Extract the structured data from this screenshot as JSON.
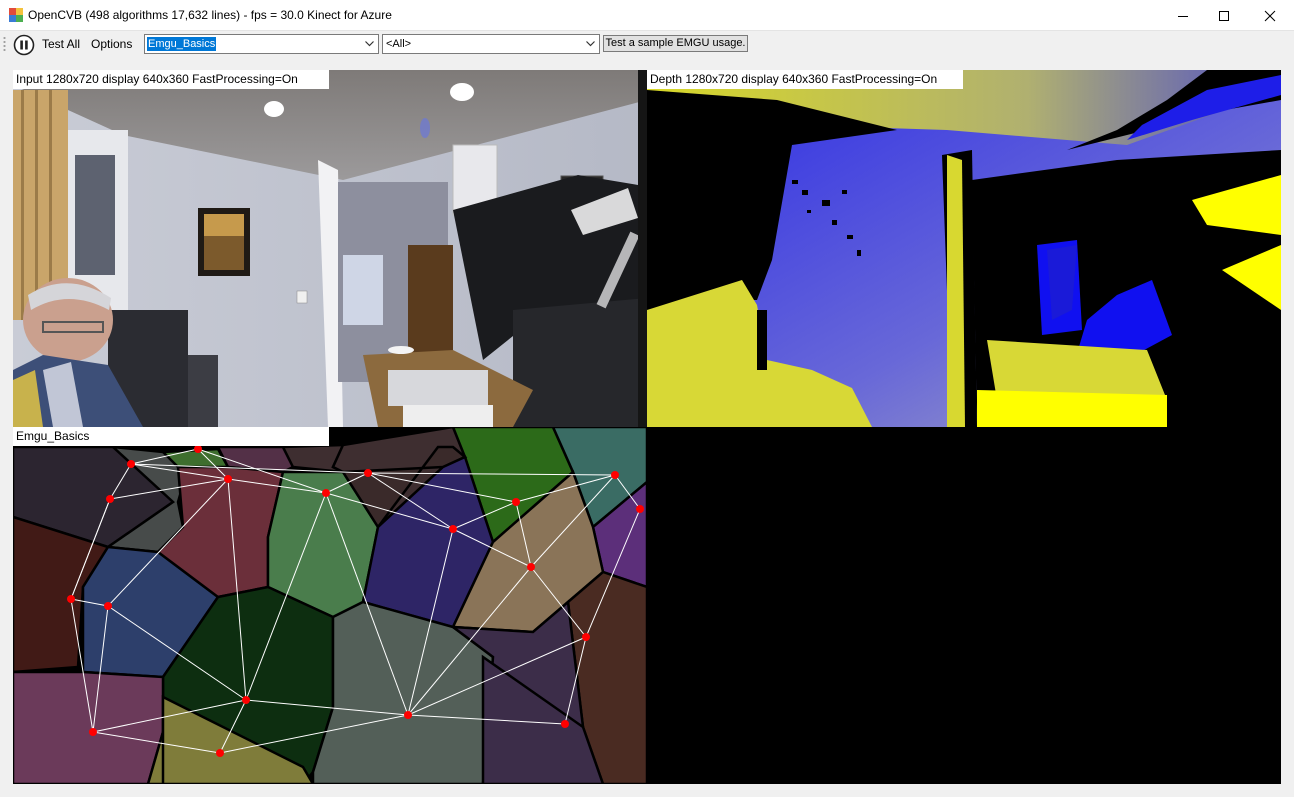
{
  "window": {
    "title": "OpenCVB (498 algorithms 17,632 lines) - fps = 30.0 Kinect for Azure",
    "app_icon": "opencvb-app-icon",
    "controls": [
      "minimize-icon",
      "maximize-icon",
      "close-icon"
    ]
  },
  "toolbar": {
    "pause_icon": "pause-icon",
    "test_all_label": "Test All",
    "options_label": "Options",
    "algorithm_combo": {
      "value": "Emgu_Basics"
    },
    "group_combo": {
      "value": "<All>"
    },
    "description_button": "Test a sample EMGU usage."
  },
  "panels": {
    "input": {
      "label": "Input  1280x720  display  640x360  FastProcessing=On"
    },
    "depth": {
      "label": "Depth  1280x720  display  640x360  FastProcessing=On"
    },
    "result1": {
      "label": "Emgu_Basics"
    },
    "result2": {
      "label": ""
    }
  },
  "colors": {
    "window_bg": "#f0f0f0",
    "selection": "#0078d7",
    "depth_yellow": "#dede2a",
    "depth_blue": "#1010f0",
    "point_red": "#ff0000",
    "voronoi_edge": "#000000",
    "delaunay_edge": "#ffffff"
  }
}
